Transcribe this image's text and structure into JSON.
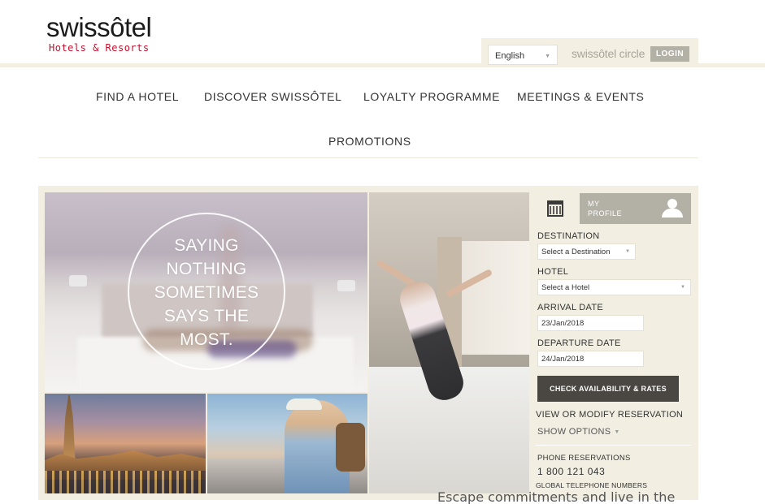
{
  "brand": {
    "name": "swissôtel",
    "tagline": "Hotels & Resorts",
    "accent_color": "#c8102e"
  },
  "utility": {
    "language": "English",
    "loyalty_brand": "swissôtel circle",
    "login_label": "LOGIN"
  },
  "nav": {
    "items": [
      "FIND A HOTEL",
      "DISCOVER SWISSÔTEL",
      "LOYALTY PROGRAMME",
      "MEETINGS & EVENTS",
      "PROMOTIONS"
    ]
  },
  "hero": {
    "slogan_lines": [
      "SAYING",
      "NOTHING",
      "SOMETIMES",
      "SAYS THE",
      "MOST."
    ]
  },
  "booking": {
    "calendar_icon": "calendar-icon",
    "profile_label_line1": "MY",
    "profile_label_line2": "PROFILE",
    "destination_label": "DESTINATION",
    "destination_value": "Select a Destination",
    "hotel_label": "HOTEL",
    "hotel_value": "Select a Hotel",
    "arrival_label": "ARRIVAL DATE",
    "arrival_value": "23/Jan/2018",
    "departure_label": "DEPARTURE DATE",
    "departure_value": "24/Jan/2018",
    "check_label": "CHECK AVAILABILITY & RATES",
    "view_modify_label": "VIEW OR MODIFY RESERVATION",
    "show_options_label": "SHOW OPTIONS",
    "phone_title": "PHONE RESERVATIONS",
    "phone_number": "1 800 121 043",
    "global_numbers_label": "GLOBAL TELEPHONE NUMBERS"
  },
  "below_fold": {
    "cutoff_text": "Escape commitments and live in the"
  }
}
